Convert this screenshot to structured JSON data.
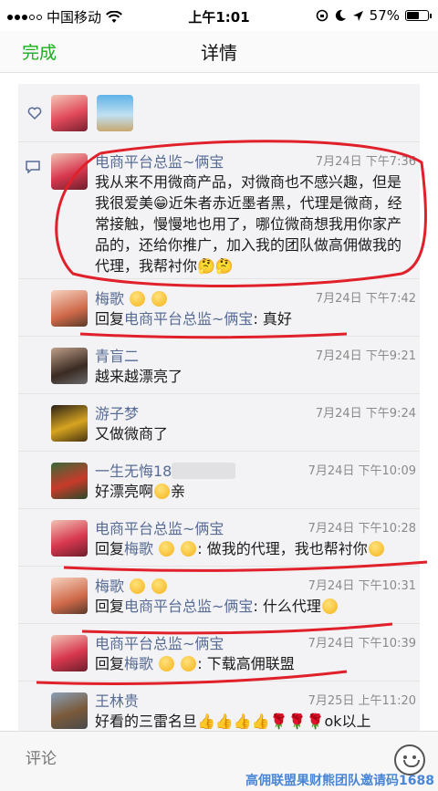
{
  "status_bar": {
    "carrier": "中国移动",
    "time": "上午1:01",
    "battery": "57%",
    "battery_level": 0.57
  },
  "nav": {
    "done_label": "完成",
    "title": "详情"
  },
  "likes": {
    "icon": "heart-outline-icon",
    "avatars": [
      "avatar-1",
      "avatar-2"
    ]
  },
  "comments": [
    {
      "name": "电商平台总监~俩宝",
      "time": "7月24日 下午7:36",
      "text": "我从来不用微商产品，对微商也不感兴趣，但是我很爱美😁近朱者赤近墨者黑，代理是微商，经常接触，慢慢地也用了，哪位微商想我用你家产品的，还给你推广，加入我的团队做高佣做我的代理，我帮衬你🤔🤔"
    },
    {
      "name": "梅歌",
      "time": "7月24日 下午7:42",
      "reply_prefix": "回复",
      "reply_to": "电商平台总监~俩宝",
      "text": ": 真好"
    },
    {
      "name": "青盲二",
      "time": "7月24日 下午9:21",
      "text": "越来越漂亮了"
    },
    {
      "name": "游子梦",
      "time": "7月24日 下午9:24",
      "text": "又做微商了"
    },
    {
      "name": "一生无悔18",
      "time": "7月24日 下午10:09",
      "text": "好漂亮啊",
      "text_after": "亲"
    },
    {
      "name": "电商平台总监~俩宝",
      "time": "7月24日 下午10:28",
      "reply_prefix": "回复",
      "reply_to": "梅歌",
      "text": ": 做我的代理，我也帮衬你"
    },
    {
      "name": "梅歌",
      "time": "7月24日 下午10:31",
      "reply_prefix": "回复",
      "reply_to": "电商平台总监~俩宝",
      "text": ": 什么代理"
    },
    {
      "name": "电商平台总监~俩宝",
      "time": "7月24日 下午10:39",
      "reply_prefix": "回复",
      "reply_to": "梅歌",
      "text": ": 下载高佣联盟"
    },
    {
      "name": "王林贵",
      "time": "7月25日 上午11:20",
      "text": "好看的三雷名旦👍👍👍👍🌹🌹🌹ok以上"
    }
  ],
  "input": {
    "placeholder": "评论"
  },
  "watermark": "高佣联盟果财熊团队邀请码1688",
  "colors": {
    "accent_green": "#1aad19",
    "name_blue": "#576b95",
    "scribble_red": "#e0202a"
  }
}
